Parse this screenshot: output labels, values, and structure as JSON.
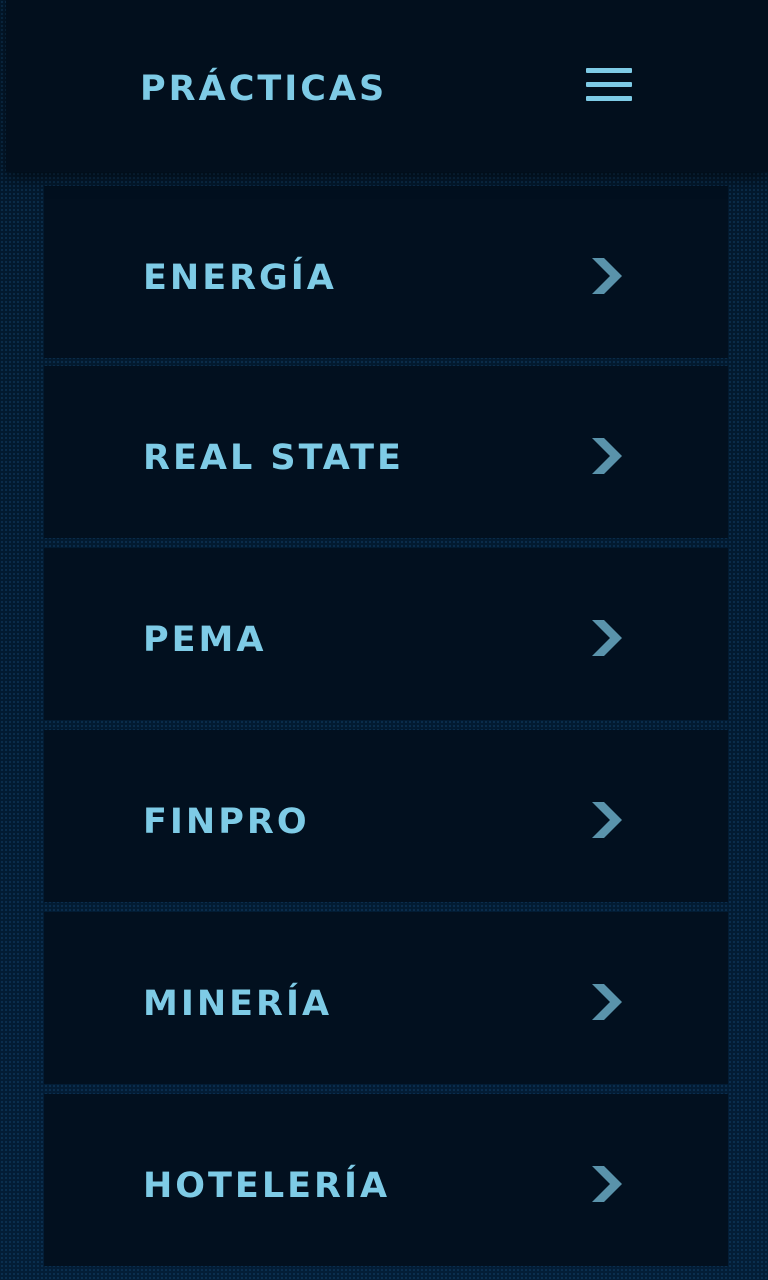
{
  "colors": {
    "accent_text": "#7ecbe6",
    "chevron": "#5a93ab",
    "background": "#02172b",
    "panel": "#02101f",
    "header": "#020f1d"
  },
  "header": {
    "title": "PRÁCTICAS",
    "menu_icon": "hamburger-menu-icon"
  },
  "list": {
    "chevron_icon": "chevron-right-icon",
    "items": [
      {
        "label": "ENERGÍA"
      },
      {
        "label": "REAL STATE"
      },
      {
        "label": "PEMA"
      },
      {
        "label": "FINPRO"
      },
      {
        "label": "MINERÍA"
      },
      {
        "label": "HOTELERÍA"
      }
    ]
  }
}
